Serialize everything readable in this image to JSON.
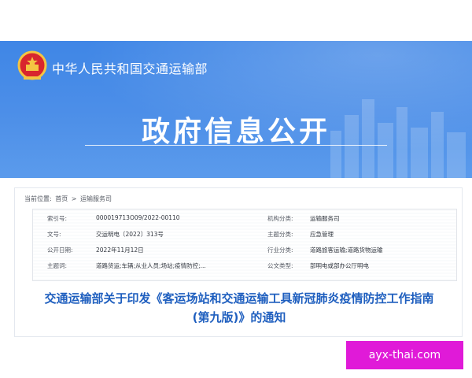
{
  "header": {
    "org_name": "中华人民共和国交通运输部",
    "title": "政府信息公开"
  },
  "breadcrumb": {
    "prefix": "当前位置:",
    "home": "首页",
    "separator": ">",
    "current": "运输服务司"
  },
  "info": {
    "rows": [
      {
        "k1": "索引号:",
        "v1": "000019713O09/2022-00110",
        "k2": "机构分类:",
        "v2": "运输服务司"
      },
      {
        "k1": "文号:",
        "v1": "交运明电〔2022〕313号",
        "k2": "主题分类:",
        "v2": "应急管理"
      },
      {
        "k1": "公开日期:",
        "v1": "2022年11月12日",
        "k2": "行业分类:",
        "v2": "道路旅客运输;道路货物运输"
      },
      {
        "k1": "主题词:",
        "v1": "道路货运;车辆;从业人员;场站;疫情防控;...",
        "k2": "公文类型:",
        "v2": "部明电或部办公厅明电"
      }
    ]
  },
  "document": {
    "title_line1": "交通运输部关于印发《客运场站和交通运输工具新冠肺炎疫情防控工作指南",
    "title_line2": "(第九版)》的通知"
  },
  "watermark": "ayx-thai.com",
  "colors": {
    "banner_blue": "#4a8ce8",
    "title_blue": "#1f5fbf",
    "watermark_magenta": "#e01ad8"
  },
  "icons": {
    "emblem": "national-emblem-icon"
  }
}
